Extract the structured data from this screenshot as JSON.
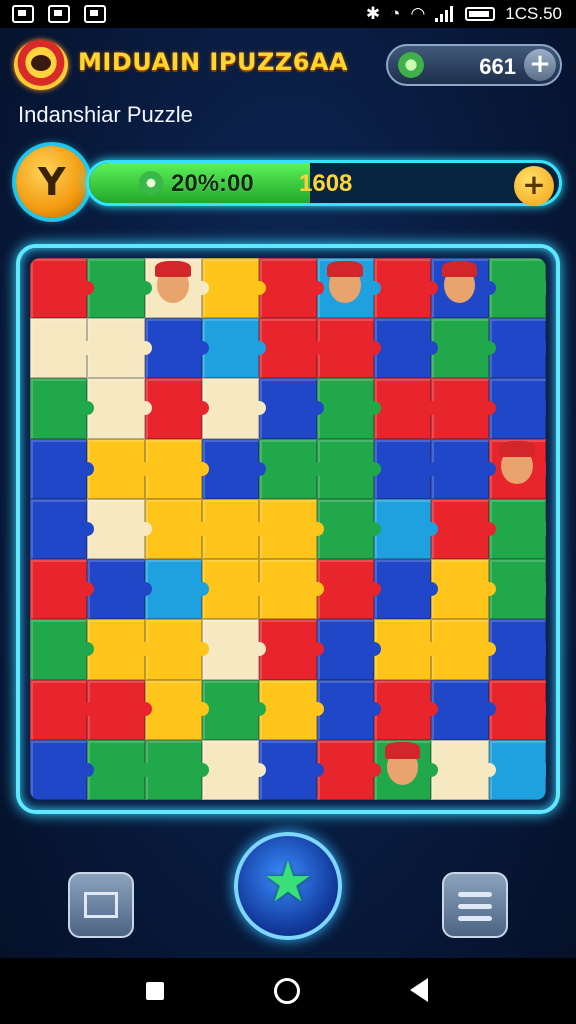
{
  "status_bar": {
    "left_icons": [
      "music-note-icon",
      "photo-icon",
      "download-icon"
    ],
    "right_icons": [
      "bluetooth-icon",
      "alarm-icon",
      "wifi-icon",
      "signal-icon",
      "battery-icon"
    ],
    "time": "1CS.50"
  },
  "header": {
    "logo_icon": "game-logo-icon",
    "title": "MIDUAIN IPUZZ6AA",
    "coins_icon": "leaf-coin-icon",
    "coins_value": "661",
    "coins_add_symbol": "+"
  },
  "subtitle": "Indanshiar Puzzle",
  "progress": {
    "trophy_icon": "trophy-icon",
    "trophy_glyph": "Y",
    "percent_label": "20%:00",
    "fill_fraction": 0.47,
    "score": "1608",
    "add_symbol": "+",
    "accent_color": "#34e4ff",
    "fill_color": "#3fd641"
  },
  "board": {
    "rows": [
      [
        "red",
        "green",
        "cream",
        "yellow",
        "red",
        "cyan",
        "red",
        "blue",
        "green"
      ],
      [
        "cream",
        "cream",
        "blue",
        "cyan",
        "red",
        "red",
        "blue",
        "green",
        "blue"
      ],
      [
        "green",
        "cream",
        "red",
        "cream",
        "blue",
        "green",
        "red",
        "red",
        "blue"
      ],
      [
        "blue",
        "yellow",
        "yellow",
        "blue",
        "green",
        "green",
        "blue",
        "blue",
        "red"
      ],
      [
        "blue",
        "cream",
        "yellow",
        "yellow",
        "yellow",
        "green",
        "cyan",
        "red",
        "green"
      ],
      [
        "red",
        "blue",
        "cyan",
        "yellow",
        "yellow",
        "red",
        "blue",
        "yellow",
        "green"
      ],
      [
        "green",
        "yellow",
        "yellow",
        "cream",
        "red",
        "blue",
        "yellow",
        "yellow",
        "blue"
      ],
      [
        "red",
        "red",
        "yellow",
        "green",
        "yellow",
        "blue",
        "red",
        "blue",
        "red"
      ],
      [
        "blue",
        "green",
        "green",
        "cream",
        "blue",
        "red",
        "green",
        "cream",
        "cyan"
      ]
    ],
    "face_cells": [
      [
        0,
        2
      ],
      [
        0,
        5
      ],
      [
        0,
        7
      ],
      [
        3,
        8
      ],
      [
        8,
        6
      ]
    ]
  },
  "buttons": {
    "mail_icon": "mail-icon",
    "play_icon": "star-icon",
    "play_glyph": "★",
    "menu_icon": "menu-icon"
  },
  "nav": [
    "recent-apps-icon",
    "home-icon",
    "back-icon"
  ]
}
